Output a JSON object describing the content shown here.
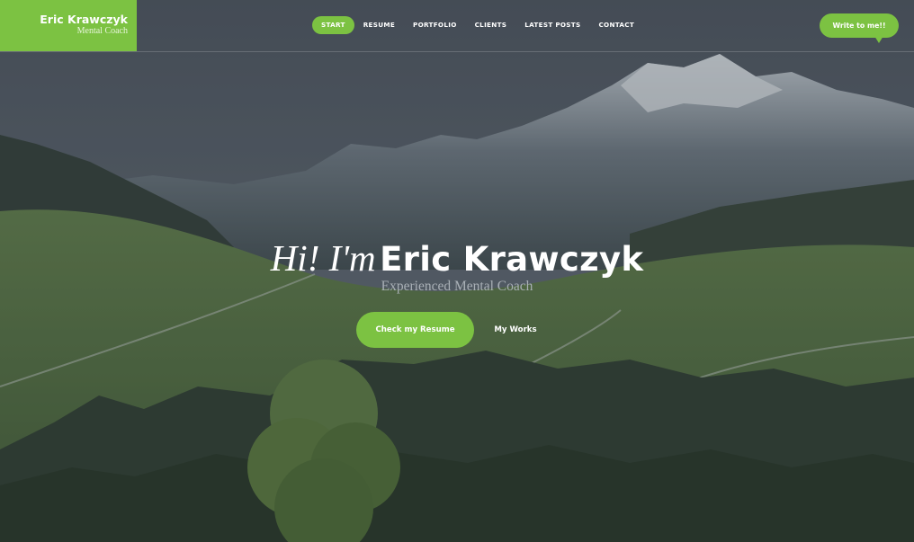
{
  "brand": {
    "name": "Eric Krawczyk",
    "tagline": "Mental Coach"
  },
  "nav": {
    "items": [
      {
        "label": "START",
        "active": true
      },
      {
        "label": "RESUME"
      },
      {
        "label": "PORTFOLIO"
      },
      {
        "label": "CLIENTS"
      },
      {
        "label": "LATEST POSTS"
      },
      {
        "label": "CONTACT"
      }
    ]
  },
  "header": {
    "cta_label": "Write to me!!"
  },
  "hero": {
    "greeting": "Hi! I'm",
    "name": "Eric Krawczyk",
    "subtitle": "Experienced Mental Coach",
    "primary_button": "Check my Resume",
    "secondary_button": "My Works"
  },
  "colors": {
    "accent": "#7cc242",
    "text": "#ffffff",
    "subtitle": "#a9b0b6"
  }
}
